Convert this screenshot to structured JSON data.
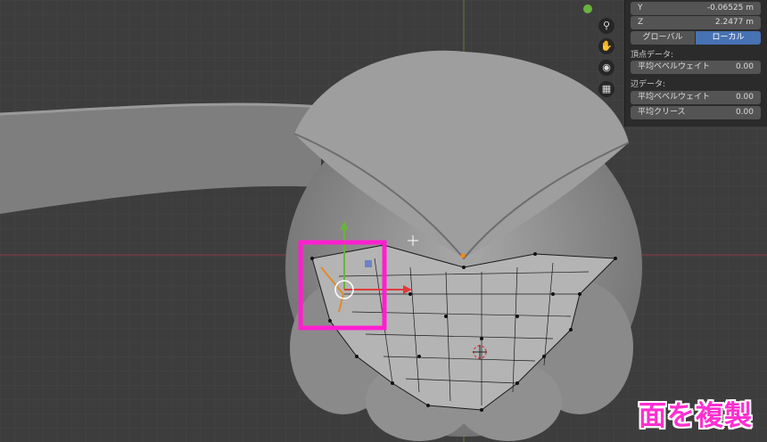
{
  "panel": {
    "y_label": "Y",
    "y_value": "-0.06525 m",
    "z_label": "Z",
    "z_value": "2.2477 m",
    "toggle_global": "グローバル",
    "toggle_local": "ローカル",
    "vertex_section": "頂点データ:",
    "vertex_bevel_label": "平均ベベルウェイト",
    "vertex_bevel_value": "0.00",
    "edge_section": "辺データ:",
    "edge_bevel_label": "平均ベベルウェイト",
    "edge_bevel_value": "0.00",
    "edge_crease_label": "平均クリース",
    "edge_crease_value": "0.00"
  },
  "navigation_icons": [
    "zoom-icon",
    "hand-pan-icon",
    "camera-icon",
    "grid-icon"
  ],
  "caption": "面を複製",
  "colors": {
    "highlight": "#ff1fcf",
    "axis_red": "#e03a3a",
    "axis_green": "#6ab23e",
    "active_toggle": "#4772b3"
  }
}
